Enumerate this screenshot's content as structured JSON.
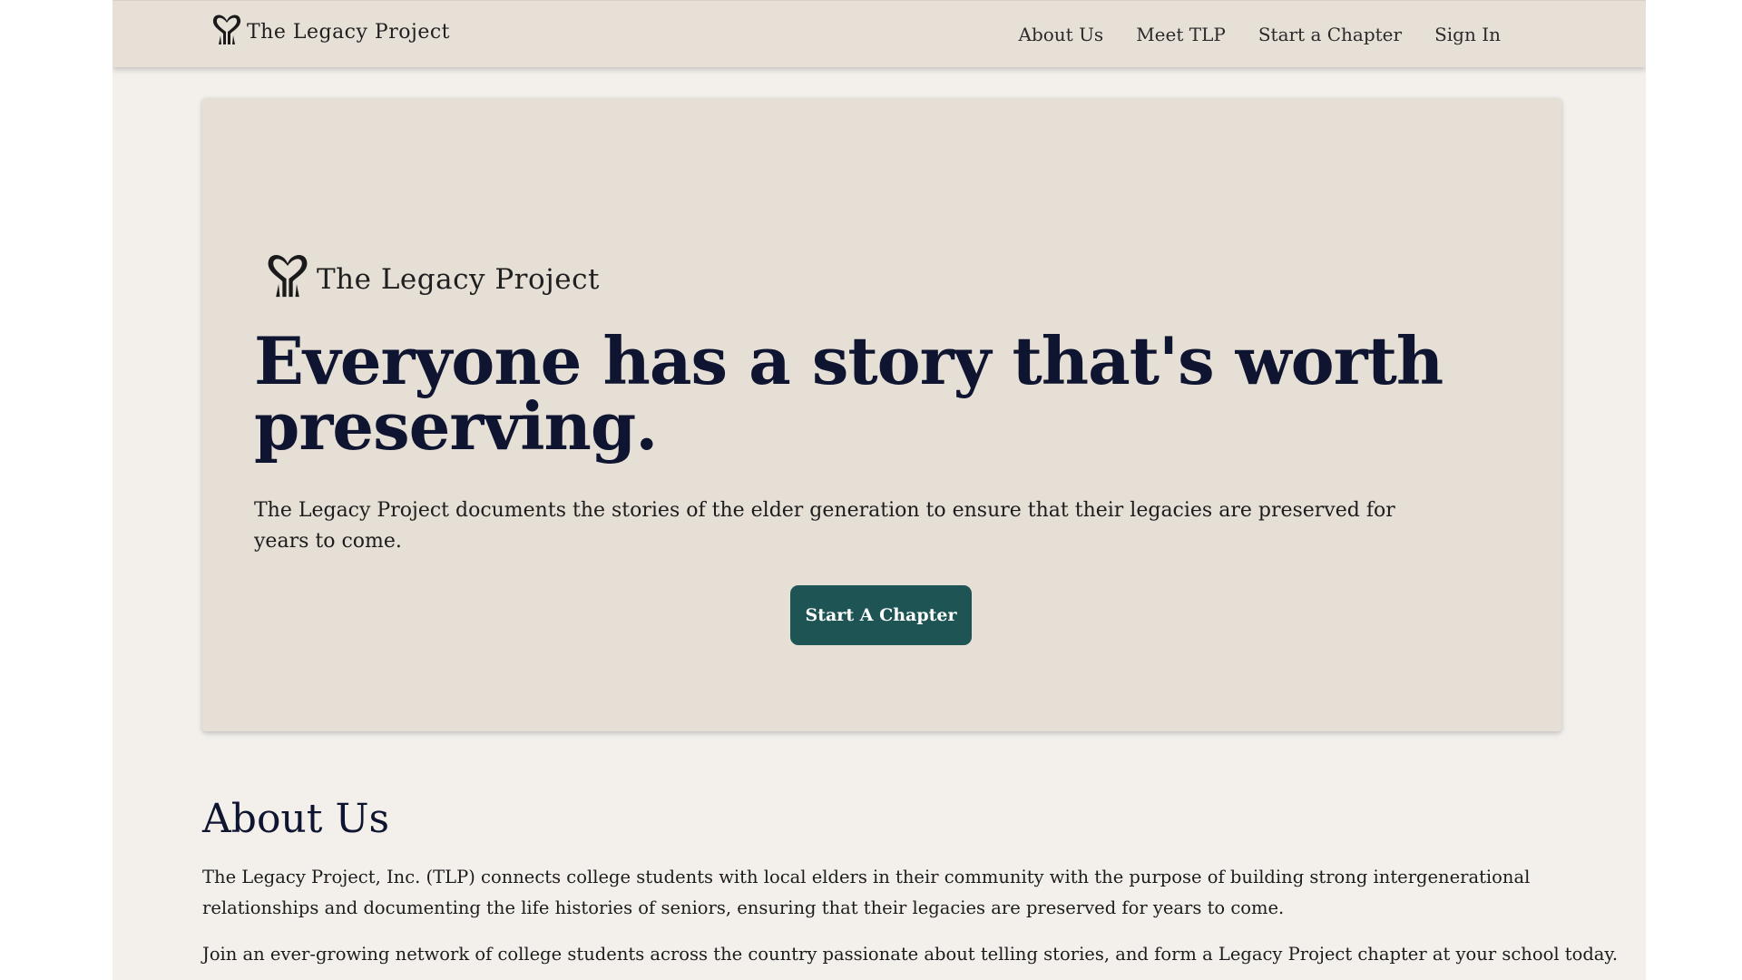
{
  "colors": {
    "page_background": "#f3f0ec",
    "navbar_background": "#e7e0d7",
    "hero_background": "#e6dfd6",
    "heading": "#0f1530",
    "cta_background": "#1f5454",
    "cta_text": "#ffffff"
  },
  "navbar": {
    "logo_text": "The Legacy Project",
    "logo_icon": "heart-hands-icon",
    "links": [
      {
        "label": "About Us"
      },
      {
        "label": "Meet TLP"
      },
      {
        "label": "Start a Chapter"
      },
      {
        "label": "Sign In"
      }
    ]
  },
  "hero": {
    "logo_text": "The Legacy Project",
    "logo_icon": "heart-hands-icon",
    "title": "Everyone has a story that's worth preserving.",
    "subtitle": "The Legacy Project documents the stories of the elder generation to ensure that their legacies are preserved for years to come.",
    "cta_label": "Start A Chapter"
  },
  "about": {
    "title": "About Us",
    "paragraph_1": "The Legacy Project, Inc. (TLP) connects college students with local elders in their community with the purpose of building strong intergenerational relationships and documenting the life histories of seniors, ensuring that their legacies are preserved for years to come.",
    "paragraph_2": "Join an ever-growing network of college students across the country passionate about telling stories, and form a Legacy Project chapter at your school today."
  }
}
